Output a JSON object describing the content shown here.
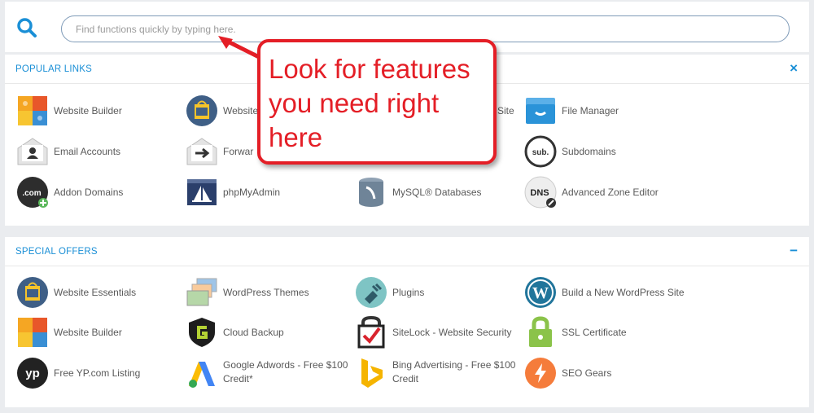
{
  "search": {
    "placeholder": "Find functions quickly by typing here."
  },
  "popular": {
    "title": "POPULAR LINKS",
    "items": [
      {
        "label": "Website Builder",
        "icon": "website-builder-icon"
      },
      {
        "label": "Website",
        "icon": "website-essentials-icon"
      },
      {
        "label": "Site",
        "icon": "site-icon"
      },
      {
        "label": "File Manager",
        "icon": "file-manager-icon"
      },
      {
        "label": "Email Accounts",
        "icon": "email-accounts-icon"
      },
      {
        "label": "Forwar",
        "icon": "forwarders-icon"
      },
      {
        "label": "Subdomains",
        "icon": "subdomains-icon"
      },
      {
        "label": "Addon Domains",
        "icon": "addon-domains-icon"
      },
      {
        "label": "phpMyAdmin",
        "icon": "phpmyadmin-icon"
      },
      {
        "label": "MySQL® Databases",
        "icon": "mysql-databases-icon"
      },
      {
        "label": "Advanced Zone Editor",
        "icon": "dns-zone-editor-icon"
      }
    ]
  },
  "offers": {
    "title": "SPECIAL OFFERS",
    "items": [
      {
        "label": "Website Essentials",
        "icon": "website-essentials-icon"
      },
      {
        "label": "WordPress Themes",
        "icon": "wordpress-themes-icon"
      },
      {
        "label": "Plugins",
        "icon": "plugins-icon"
      },
      {
        "label": "Build a New WordPress Site",
        "icon": "wordpress-icon"
      },
      {
        "label": "Website Builder",
        "icon": "website-builder-icon"
      },
      {
        "label": "Cloud Backup",
        "icon": "cloud-backup-icon"
      },
      {
        "label": "SiteLock - Website Security",
        "icon": "sitelock-icon"
      },
      {
        "label": "SSL Certificate",
        "icon": "ssl-lock-icon"
      },
      {
        "label": "Free YP.com Listing",
        "icon": "yp-icon"
      },
      {
        "label": "Google Adwords - Free $100 Credit*",
        "icon": "google-adwords-icon"
      },
      {
        "label": "Bing Advertising - Free $100 Credit",
        "icon": "bing-icon"
      },
      {
        "label": "SEO Gears",
        "icon": "seo-gears-icon"
      }
    ]
  },
  "callout": {
    "text": "Look for features you need right here"
  },
  "colors": {
    "accent": "#1a8fd6",
    "callout": "#e41e26"
  }
}
